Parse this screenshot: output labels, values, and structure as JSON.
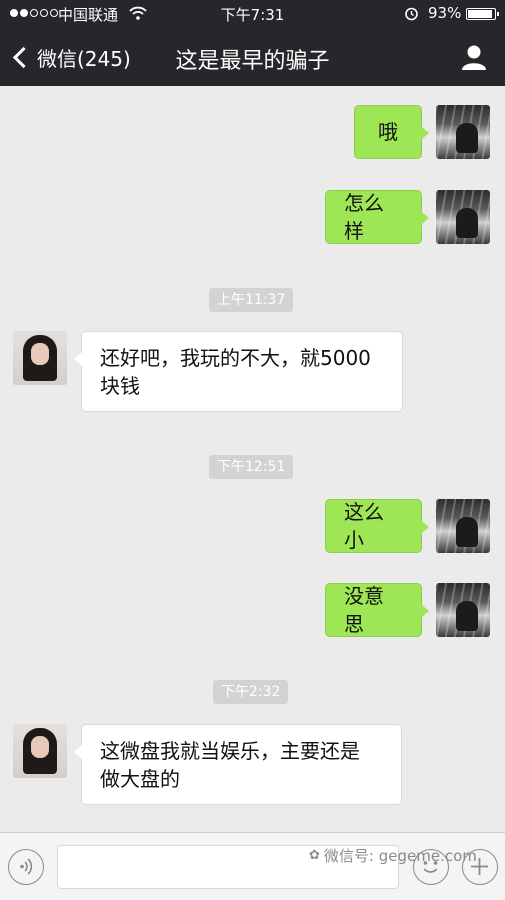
{
  "status_bar": {
    "carrier": "中国联通",
    "time": "下午7:31",
    "battery": "93%"
  },
  "nav": {
    "back_label": "微信(245)",
    "title": "这是最早的骗子"
  },
  "messages": [
    {
      "side": "right",
      "text_lines": [
        "哦"
      ]
    },
    {
      "side": "right",
      "text_lines": [
        "怎么样"
      ]
    },
    {
      "timestamp": "上午11:37"
    },
    {
      "side": "left",
      "text_lines": [
        "还好吧，我玩的不大，就5000",
        "块钱"
      ]
    },
    {
      "timestamp": "下午12:51"
    },
    {
      "side": "right",
      "text_lines": [
        "这么小"
      ]
    },
    {
      "side": "right",
      "text_lines": [
        "没意思"
      ]
    },
    {
      "timestamp": "下午2:32"
    },
    {
      "side": "left",
      "text_lines": [
        "这微盘我就当娱乐，主要还是",
        "做大盘的"
      ]
    }
  ],
  "input_bar": {
    "placeholder": "",
    "watermark": "微信号: gegeme.com"
  },
  "colors": {
    "nav_bg": "#26262b",
    "chat_bg": "#ebebeb",
    "bubble_self": "#9fe657",
    "bubble_other": "#ffffff"
  },
  "icons": {
    "back": "chevron-left-icon",
    "profile": "person-icon",
    "voice": "voice-icon",
    "emoji": "emoji-icon",
    "more": "plus-icon"
  }
}
